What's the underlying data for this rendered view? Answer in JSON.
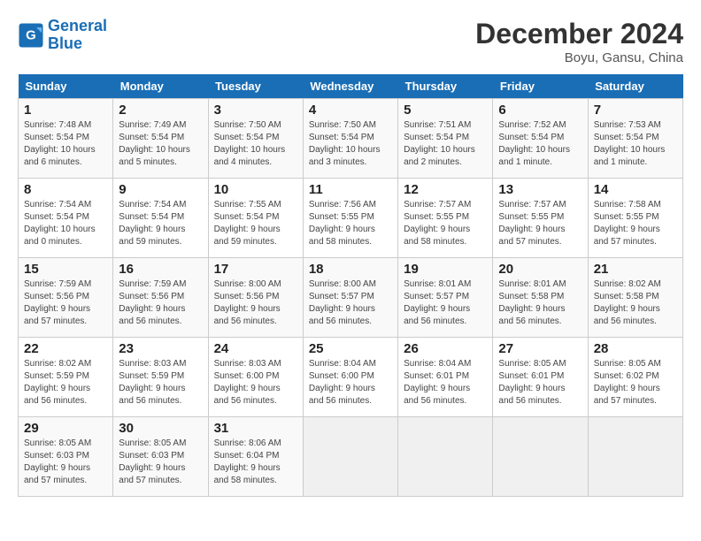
{
  "logo": {
    "line1": "General",
    "line2": "Blue"
  },
  "title": "December 2024",
  "location": "Boyu, Gansu, China",
  "days_of_week": [
    "Sunday",
    "Monday",
    "Tuesday",
    "Wednesday",
    "Thursday",
    "Friday",
    "Saturday"
  ],
  "weeks": [
    [
      {
        "day": 1,
        "info": "Sunrise: 7:48 AM\nSunset: 5:54 PM\nDaylight: 10 hours\nand 6 minutes."
      },
      {
        "day": 2,
        "info": "Sunrise: 7:49 AM\nSunset: 5:54 PM\nDaylight: 10 hours\nand 5 minutes."
      },
      {
        "day": 3,
        "info": "Sunrise: 7:50 AM\nSunset: 5:54 PM\nDaylight: 10 hours\nand 4 minutes."
      },
      {
        "day": 4,
        "info": "Sunrise: 7:50 AM\nSunset: 5:54 PM\nDaylight: 10 hours\nand 3 minutes."
      },
      {
        "day": 5,
        "info": "Sunrise: 7:51 AM\nSunset: 5:54 PM\nDaylight: 10 hours\nand 2 minutes."
      },
      {
        "day": 6,
        "info": "Sunrise: 7:52 AM\nSunset: 5:54 PM\nDaylight: 10 hours\nand 1 minute."
      },
      {
        "day": 7,
        "info": "Sunrise: 7:53 AM\nSunset: 5:54 PM\nDaylight: 10 hours\nand 1 minute."
      }
    ],
    [
      {
        "day": 8,
        "info": "Sunrise: 7:54 AM\nSunset: 5:54 PM\nDaylight: 10 hours\nand 0 minutes."
      },
      {
        "day": 9,
        "info": "Sunrise: 7:54 AM\nSunset: 5:54 PM\nDaylight: 9 hours\nand 59 minutes."
      },
      {
        "day": 10,
        "info": "Sunrise: 7:55 AM\nSunset: 5:54 PM\nDaylight: 9 hours\nand 59 minutes."
      },
      {
        "day": 11,
        "info": "Sunrise: 7:56 AM\nSunset: 5:55 PM\nDaylight: 9 hours\nand 58 minutes."
      },
      {
        "day": 12,
        "info": "Sunrise: 7:57 AM\nSunset: 5:55 PM\nDaylight: 9 hours\nand 58 minutes."
      },
      {
        "day": 13,
        "info": "Sunrise: 7:57 AM\nSunset: 5:55 PM\nDaylight: 9 hours\nand 57 minutes."
      },
      {
        "day": 14,
        "info": "Sunrise: 7:58 AM\nSunset: 5:55 PM\nDaylight: 9 hours\nand 57 minutes."
      }
    ],
    [
      {
        "day": 15,
        "info": "Sunrise: 7:59 AM\nSunset: 5:56 PM\nDaylight: 9 hours\nand 57 minutes."
      },
      {
        "day": 16,
        "info": "Sunrise: 7:59 AM\nSunset: 5:56 PM\nDaylight: 9 hours\nand 56 minutes."
      },
      {
        "day": 17,
        "info": "Sunrise: 8:00 AM\nSunset: 5:56 PM\nDaylight: 9 hours\nand 56 minutes."
      },
      {
        "day": 18,
        "info": "Sunrise: 8:00 AM\nSunset: 5:57 PM\nDaylight: 9 hours\nand 56 minutes."
      },
      {
        "day": 19,
        "info": "Sunrise: 8:01 AM\nSunset: 5:57 PM\nDaylight: 9 hours\nand 56 minutes."
      },
      {
        "day": 20,
        "info": "Sunrise: 8:01 AM\nSunset: 5:58 PM\nDaylight: 9 hours\nand 56 minutes."
      },
      {
        "day": 21,
        "info": "Sunrise: 8:02 AM\nSunset: 5:58 PM\nDaylight: 9 hours\nand 56 minutes."
      }
    ],
    [
      {
        "day": 22,
        "info": "Sunrise: 8:02 AM\nSunset: 5:59 PM\nDaylight: 9 hours\nand 56 minutes."
      },
      {
        "day": 23,
        "info": "Sunrise: 8:03 AM\nSunset: 5:59 PM\nDaylight: 9 hours\nand 56 minutes."
      },
      {
        "day": 24,
        "info": "Sunrise: 8:03 AM\nSunset: 6:00 PM\nDaylight: 9 hours\nand 56 minutes."
      },
      {
        "day": 25,
        "info": "Sunrise: 8:04 AM\nSunset: 6:00 PM\nDaylight: 9 hours\nand 56 minutes."
      },
      {
        "day": 26,
        "info": "Sunrise: 8:04 AM\nSunset: 6:01 PM\nDaylight: 9 hours\nand 56 minutes."
      },
      {
        "day": 27,
        "info": "Sunrise: 8:05 AM\nSunset: 6:01 PM\nDaylight: 9 hours\nand 56 minutes."
      },
      {
        "day": 28,
        "info": "Sunrise: 8:05 AM\nSunset: 6:02 PM\nDaylight: 9 hours\nand 57 minutes."
      }
    ],
    [
      {
        "day": 29,
        "info": "Sunrise: 8:05 AM\nSunset: 6:03 PM\nDaylight: 9 hours\nand 57 minutes."
      },
      {
        "day": 30,
        "info": "Sunrise: 8:05 AM\nSunset: 6:03 PM\nDaylight: 9 hours\nand 57 minutes."
      },
      {
        "day": 31,
        "info": "Sunrise: 8:06 AM\nSunset: 6:04 PM\nDaylight: 9 hours\nand 58 minutes."
      },
      null,
      null,
      null,
      null
    ]
  ]
}
